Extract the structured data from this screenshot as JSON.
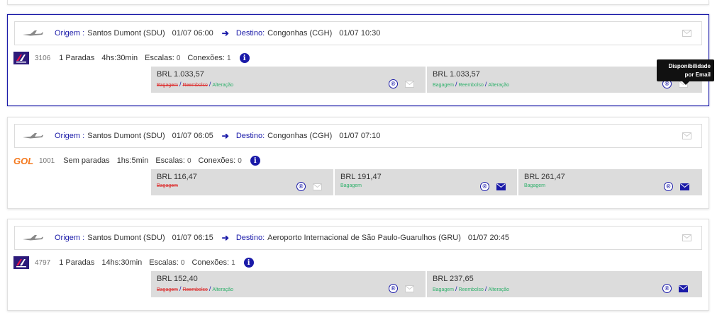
{
  "labels": {
    "origem": "Origem :",
    "destino": "Destino:",
    "escalas": "Escalas:",
    "conexoes": "Conexões:",
    "bagagem": "Bagagem",
    "reembolso": "Reembolso",
    "alteracao": "Alteração",
    "sep": "/",
    "reg_symbol": "®",
    "info_symbol": "i"
  },
  "tooltip": {
    "line1": "Disponibilidade",
    "line2": "por Email"
  },
  "colors": {
    "brand_blue": "#1a1aa8",
    "tag_available": "#2fb06b",
    "tag_unavailable": "#dd3333",
    "fare_bg": "#dcdcdc",
    "gol_orange": "#f47a20",
    "latam_purple": "#2d1b7b"
  },
  "icons": {
    "plane": "plane-icon",
    "arrow": "arrow-right-icon",
    "mail": "envelope-icon",
    "info": "info-icon",
    "registered": "registered-icon"
  },
  "flights": [
    {
      "origem": "Santos Dumont (SDU)",
      "origem_time": "01/07 06:00",
      "destino": "Congonhas (CGH)",
      "destino_time": "01/07 10:30",
      "airline": "LATAM",
      "flight_no": "3106",
      "paradas": "1 Paradas",
      "duration": "4hs:30min",
      "escalas": "0",
      "conexoes": "1",
      "fares": [
        {
          "price": "BRL 1.033,57",
          "bagagem": false,
          "reembolso": false,
          "alteracao": true,
          "mail_active": false
        },
        {
          "price": "BRL 1.033,57",
          "bagagem": true,
          "reembolso": true,
          "alteracao": true,
          "mail_active": false
        }
      ]
    },
    {
      "origem": "Santos Dumont (SDU)",
      "origem_time": "01/07 06:05",
      "destino": "Congonhas (CGH)",
      "destino_time": "01/07 07:10",
      "airline": "GOL",
      "flight_no": "1001",
      "paradas": "Sem paradas",
      "duration": "1hs:5min",
      "escalas": "0",
      "conexoes": "0",
      "fares": [
        {
          "price": "BRL 116,47",
          "bagagem": false,
          "mail_active": false
        },
        {
          "price": "BRL 191,47",
          "bagagem": true,
          "mail_active": true
        },
        {
          "price": "BRL 261,47",
          "bagagem": true,
          "mail_active": true
        }
      ]
    },
    {
      "origem": "Santos Dumont (SDU)",
      "origem_time": "01/07 06:15",
      "destino": "Aeroporto Internacional de São Paulo-Guarulhos (GRU)",
      "destino_time": "01/07 20:45",
      "airline": "LATAM",
      "flight_no": "4797",
      "paradas": "1 Paradas",
      "duration": "14hs:30min",
      "escalas": "0",
      "conexoes": "1",
      "fares": [
        {
          "price": "BRL 152,40",
          "bagagem": false,
          "reembolso": false,
          "alteracao": true,
          "mail_active": false
        },
        {
          "price": "BRL 237,65",
          "bagagem": true,
          "reembolso": true,
          "alteracao": true,
          "mail_active": true
        }
      ]
    }
  ]
}
